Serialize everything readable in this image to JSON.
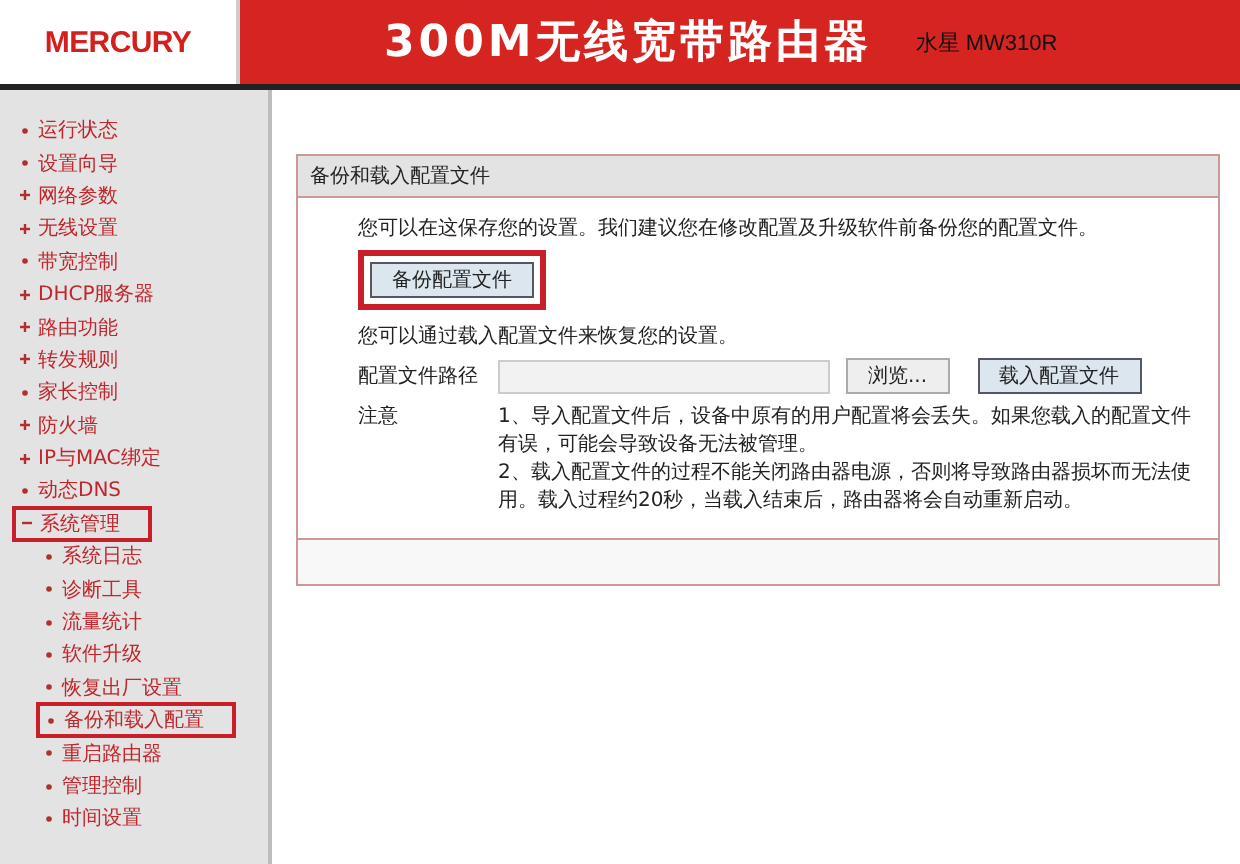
{
  "header": {
    "logo": "MERCURY",
    "title": "300M无线宽带路由器",
    "model": "水星 MW310R"
  },
  "sidebar": {
    "items": [
      {
        "label": "运行状态",
        "kind": "link",
        "highlighted": false
      },
      {
        "label": "设置向导",
        "kind": "link",
        "highlighted": false
      },
      {
        "label": "网络参数",
        "kind": "group",
        "expanded": false,
        "highlighted": false
      },
      {
        "label": "无线设置",
        "kind": "group",
        "expanded": false,
        "highlighted": false
      },
      {
        "label": "带宽控制",
        "kind": "link",
        "highlighted": false
      },
      {
        "label": "DHCP服务器",
        "kind": "group",
        "expanded": false,
        "highlighted": false
      },
      {
        "label": "路由功能",
        "kind": "group",
        "expanded": false,
        "highlighted": false
      },
      {
        "label": "转发规则",
        "kind": "group",
        "expanded": false,
        "highlighted": false
      },
      {
        "label": "家长控制",
        "kind": "link",
        "highlighted": false
      },
      {
        "label": "防火墙",
        "kind": "group",
        "expanded": false,
        "highlighted": false
      },
      {
        "label": "IP与MAC绑定",
        "kind": "group",
        "expanded": false,
        "highlighted": false
      },
      {
        "label": "动态DNS",
        "kind": "link",
        "highlighted": false
      },
      {
        "label": "系统管理",
        "kind": "group",
        "expanded": true,
        "highlighted": true,
        "children": [
          {
            "label": "系统日志",
            "selected": false
          },
          {
            "label": "诊断工具",
            "selected": false
          },
          {
            "label": "流量统计",
            "selected": false
          },
          {
            "label": "软件升级",
            "selected": false
          },
          {
            "label": "恢复出厂设置",
            "selected": false
          },
          {
            "label": "备份和载入配置",
            "selected": true
          },
          {
            "label": "重启路由器",
            "selected": false
          },
          {
            "label": "管理控制",
            "selected": false
          },
          {
            "label": "时间设置",
            "selected": false
          }
        ]
      }
    ]
  },
  "panel": {
    "title": "备份和载入配置文件",
    "backup_text": "您可以在这保存您的设置。我们建议您在修改配置及升级软件前备份您的配置文件。",
    "backup_button": {
      "label": "备份配置文件",
      "highlighted": true
    },
    "restore_text": "您可以通过载入配置文件来恢复您的设置。",
    "path_label": "配置文件路径",
    "browse_button": "浏览...",
    "load_button": "载入配置文件",
    "note_label": "注意",
    "notes": [
      "1、导入配置文件后，设备中原有的用户配置将会丢失。如果您载入的配置文件有误，可能会导致设备无法被管理。",
      "2、载入配置文件的过程不能关闭路由器电源，否则将导致路由器损坏而无法使用。载入过程约20秒，当载入结束后，路由器将会自动重新启动。"
    ]
  }
}
